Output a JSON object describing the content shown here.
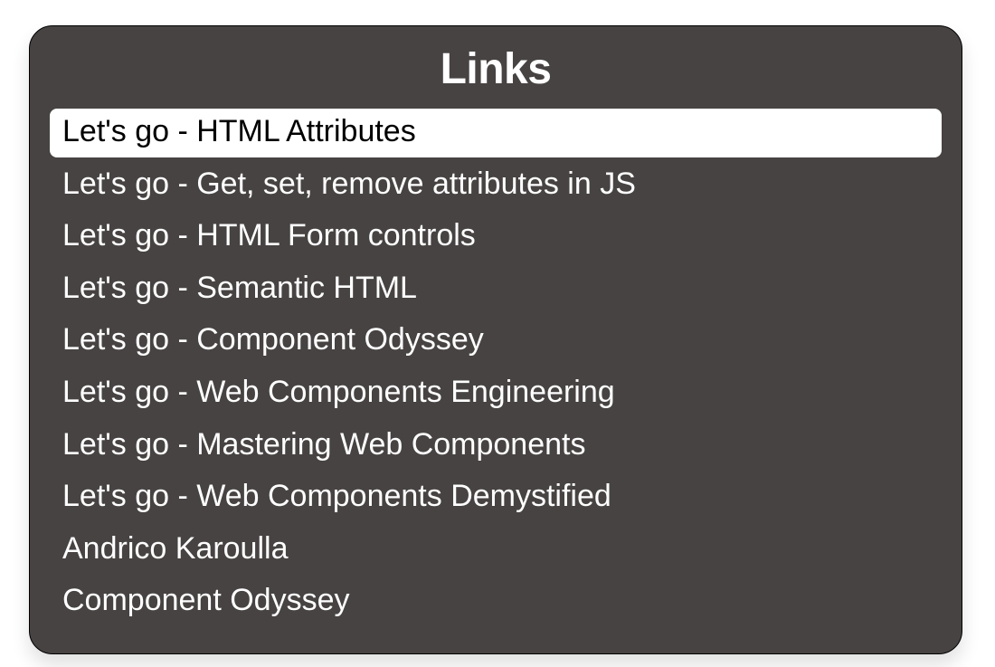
{
  "panel": {
    "title": "Links",
    "selectedIndex": 0,
    "items": [
      {
        "label": "Let's go - HTML Attributes"
      },
      {
        "label": "Let's go - Get, set, remove attributes in JS"
      },
      {
        "label": "Let's go - HTML Form controls"
      },
      {
        "label": "Let's go - Semantic HTML"
      },
      {
        "label": "Let's go - Component Odyssey"
      },
      {
        "label": "Let's go - Web Components Engineering"
      },
      {
        "label": "Let's go - Mastering Web Components"
      },
      {
        "label": "Let's go - Web Components Demystified"
      },
      {
        "label": "Andrico Karoulla"
      },
      {
        "label": "Component Odyssey"
      }
    ]
  },
  "colors": {
    "panelBg": "#474342",
    "selectedBg": "#ffffff",
    "textLight": "#ffffff",
    "textDark": "#000000"
  }
}
